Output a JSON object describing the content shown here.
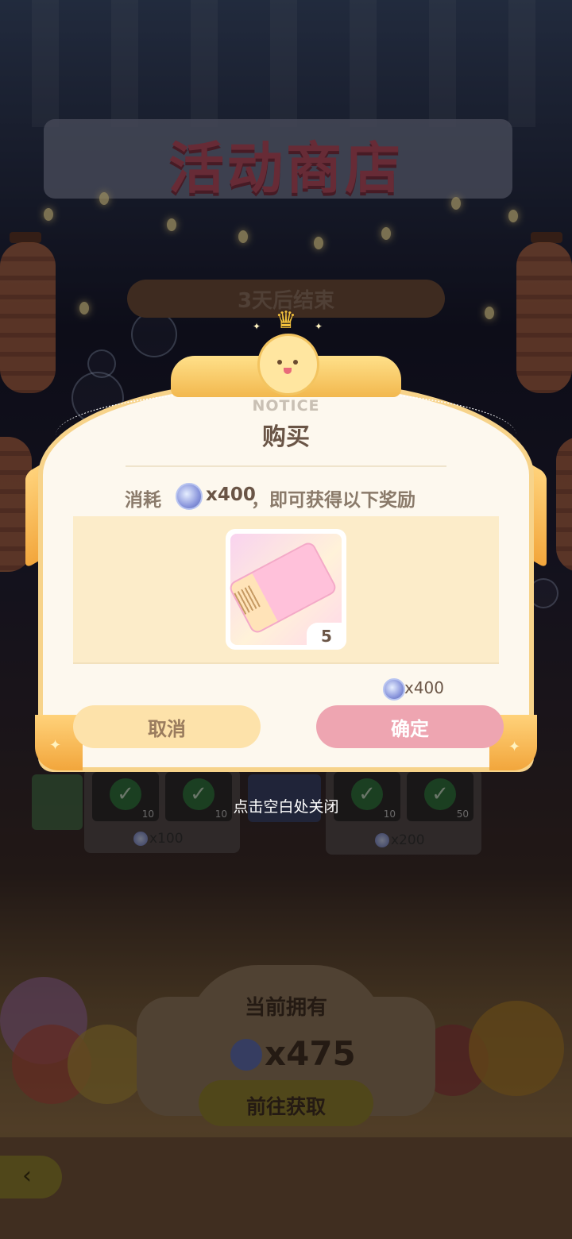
{
  "background": {
    "title": "活动商店",
    "end_countdown": "3天后结束",
    "shop_cards": [
      {
        "price": "x100",
        "slot_counts": [
          "10",
          "10"
        ]
      },
      {
        "price": "x200",
        "slot_counts": [
          "10",
          "50"
        ]
      }
    ],
    "owned_label": "当前拥有",
    "owned_amount": "x475",
    "go_get_button": "前往获取"
  },
  "dialog": {
    "notice": "NOTICE",
    "title": "购买",
    "consume_prefix": "消耗",
    "consume_amount": "x400",
    "consume_suffix": "，即可获得以下奖励",
    "reward": {
      "icon": "ticket-icon",
      "quantity": "5"
    },
    "cost_amount": "x400",
    "cancel_label": "取消",
    "confirm_label": "确定"
  },
  "close_hint": "点击空白处关闭",
  "colors": {
    "confirm": "#eea5b1",
    "cancel": "#fde2aa",
    "ribbon": "#f2b84e",
    "title_pink": "#b14a5e"
  }
}
